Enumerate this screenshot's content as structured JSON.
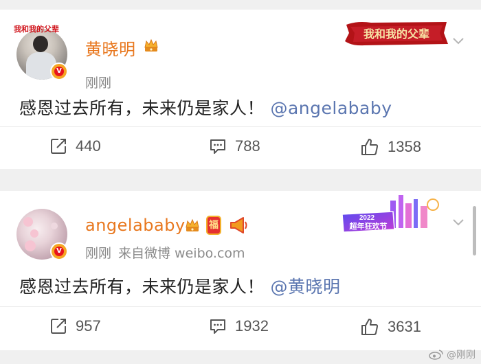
{
  "colors": {
    "username": "#e8771e",
    "mention": "#5b76b0",
    "meta": "#8a8a8a",
    "verified_ring": "#f5a623",
    "verified_dot": "#e8131d"
  },
  "posts": [
    {
      "username": "黄晓明",
      "avatar_badge_text": "我和我的父辈",
      "meta_time": "刚刚",
      "meta_source": "",
      "content_text": "感恩过去所有，未来仍是家人！",
      "mention": "@angelababy",
      "banner_text": "我和我的父辈",
      "badges": [
        "crown-icon"
      ],
      "reposts": "440",
      "comments": "788",
      "likes": "1358"
    },
    {
      "username": "angelababy",
      "meta_time": "刚刚",
      "meta_source": "来自微博 weibo.com",
      "content_text": "感恩过去所有，未来仍是家人！",
      "mention": "@黄晓明",
      "banner_year": "2022",
      "banner_text": "超年狂欢节",
      "fu_badge": "福",
      "badges": [
        "crown-icon",
        "fu-badge-icon",
        "horn-icon"
      ],
      "reposts": "957",
      "comments": "1932",
      "likes": "3631"
    }
  ],
  "watermark": "@刚刚"
}
